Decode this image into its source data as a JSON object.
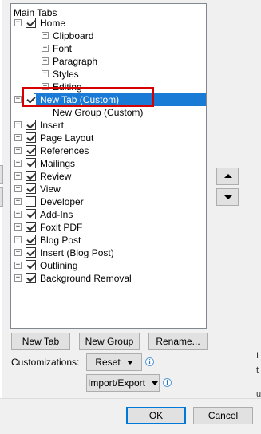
{
  "tree": {
    "header": "Main Tabs",
    "items": [
      {
        "label": "Home",
        "level": 0,
        "expander": "−",
        "checked": true
      },
      {
        "label": "Clipboard",
        "level": 1,
        "expander": "+",
        "checked": null
      },
      {
        "label": "Font",
        "level": 1,
        "expander": "+",
        "checked": null
      },
      {
        "label": "Paragraph",
        "level": 1,
        "expander": "+",
        "checked": null
      },
      {
        "label": "Styles",
        "level": 1,
        "expander": "+",
        "checked": null
      },
      {
        "label": "Editing",
        "level": 1,
        "expander": "+",
        "checked": null
      },
      {
        "label": "New Tab (Custom)",
        "level": 0,
        "expander": "−",
        "checked": true,
        "selected": true
      },
      {
        "label": "New Group (Custom)",
        "level": 1,
        "expander": null,
        "checked": null
      },
      {
        "label": "Insert",
        "level": 0,
        "expander": "+",
        "checked": true
      },
      {
        "label": "Page Layout",
        "level": 0,
        "expander": "+",
        "checked": true
      },
      {
        "label": "References",
        "level": 0,
        "expander": "+",
        "checked": true
      },
      {
        "label": "Mailings",
        "level": 0,
        "expander": "+",
        "checked": true
      },
      {
        "label": "Review",
        "level": 0,
        "expander": "+",
        "checked": true
      },
      {
        "label": "View",
        "level": 0,
        "expander": "+",
        "checked": true
      },
      {
        "label": "Developer",
        "level": 0,
        "expander": "+",
        "checked": false
      },
      {
        "label": "Add-Ins",
        "level": 0,
        "expander": "+",
        "checked": true
      },
      {
        "label": "Foxit PDF",
        "level": 0,
        "expander": "+",
        "checked": true
      },
      {
        "label": "Blog Post",
        "level": 0,
        "expander": "+",
        "checked": true
      },
      {
        "label": "Insert (Blog Post)",
        "level": 0,
        "expander": "+",
        "checked": true
      },
      {
        "label": "Outlining",
        "level": 0,
        "expander": "+",
        "checked": true
      },
      {
        "label": "Background Removal",
        "level": 0,
        "expander": "+",
        "checked": true
      }
    ]
  },
  "buttons": {
    "new_tab": "New Tab",
    "new_group": "New Group",
    "rename": "Rename...",
    "reset": "Reset",
    "import_export": "Import/Export",
    "ok": "OK",
    "cancel": "Cancel"
  },
  "customizations_label": "Customizations:",
  "info_glyph": "i",
  "right_edge_glyphs": [
    "I",
    "t",
    "u"
  ],
  "colors": {
    "selection": "#1a7bd6",
    "highlight": "#d60000",
    "accent": "#0078d7"
  }
}
